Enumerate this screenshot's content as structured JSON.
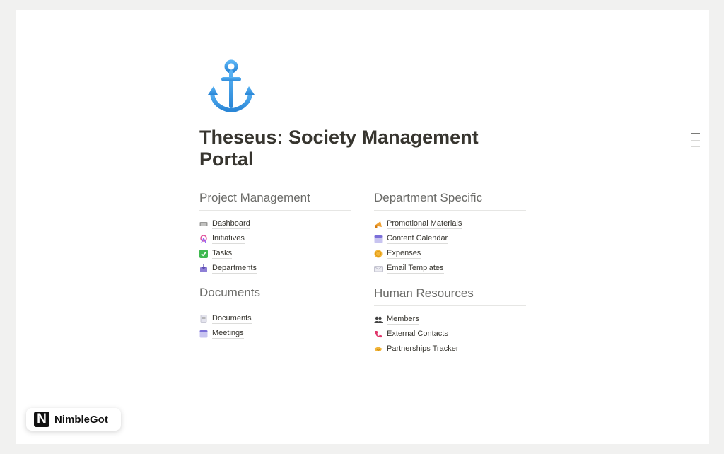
{
  "page": {
    "title": "Theseus: Society Management Portal",
    "icon": "anchor-icon"
  },
  "sections": {
    "project_management": {
      "heading": "Project Management",
      "items": [
        {
          "label": "Dashboard",
          "icon": "keyboard-icon"
        },
        {
          "label": "Initiatives",
          "icon": "ferris-wheel-icon"
        },
        {
          "label": "Tasks",
          "icon": "check-box-icon"
        },
        {
          "label": "Departments",
          "icon": "inbox-tray-icon"
        }
      ]
    },
    "documents": {
      "heading": "Documents",
      "items": [
        {
          "label": "Documents",
          "icon": "page-icon"
        },
        {
          "label": "Meetings",
          "icon": "calendar-icon"
        }
      ]
    },
    "department_specific": {
      "heading": "Department Specific",
      "items": [
        {
          "label": "Promotional Materials",
          "icon": "megaphone-icon"
        },
        {
          "label": "Content Calendar",
          "icon": "calendar-icon"
        },
        {
          "label": "Expenses",
          "icon": "coin-icon"
        },
        {
          "label": "Email Templates",
          "icon": "envelope-icon"
        }
      ]
    },
    "human_resources": {
      "heading": "Human Resources",
      "items": [
        {
          "label": "Members",
          "icon": "people-icon"
        },
        {
          "label": "External Contacts",
          "icon": "telephone-icon"
        },
        {
          "label": "Partnerships Tracker",
          "icon": "handshake-icon"
        }
      ]
    }
  },
  "badge": {
    "logo_letter": "N",
    "text": "NimbleGot"
  },
  "colors": {
    "anchor": "#3b9de8",
    "heading_text": "#6b6b68",
    "page_background": "#ffffff"
  }
}
